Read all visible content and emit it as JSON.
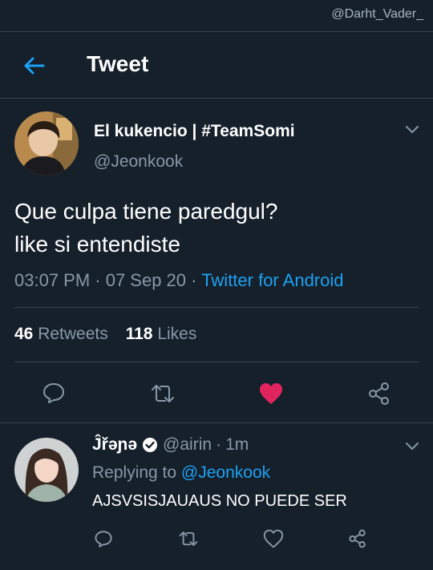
{
  "watermark": "@Darht_Vader_",
  "header": {
    "title": "Tweet"
  },
  "tweet": {
    "display_name": "El kukencio | #TeamSomi",
    "handle": "@Jeonkook",
    "text_line1": "Que culpa tiene paredgul?",
    "text_line2": "like si entendiste",
    "timestamp": "03:07 PM · 07 Sep 20 · ",
    "source": "Twitter for Android",
    "retweets_count": "46",
    "retweets_label": "Retweets",
    "likes_count": "118",
    "likes_label": "Likes"
  },
  "reply": {
    "display_name": "Ĵřəɲə",
    "handle": "@airin",
    "age": "1m",
    "replying_prefix": "Replying to ",
    "replying_to": "@Jeonkook",
    "text": "AJSVSISJAUAUS NO PUEDE SER"
  },
  "colors": {
    "background": "#15202b",
    "accent": "#1da1f2",
    "like": "#e0245e",
    "muted": "#8899a6",
    "divider": "#38444d"
  },
  "icons": [
    "back-arrow-icon",
    "chevron-down-icon",
    "reply-icon",
    "retweet-icon",
    "heart-icon",
    "share-icon",
    "verified-icon"
  ]
}
